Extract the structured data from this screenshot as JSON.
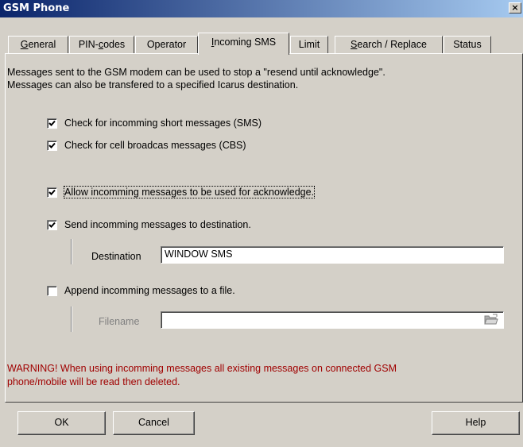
{
  "window": {
    "title": "GSM Phone",
    "close_glyph": "×"
  },
  "tabs": [
    {
      "prefix": "",
      "ul": "G",
      "rest": "eneral"
    },
    {
      "prefix": "PIN-",
      "ul": "c",
      "rest": "odes"
    },
    {
      "prefix": "Operator",
      "ul": "",
      "rest": ""
    },
    {
      "prefix": "",
      "ul": "I",
      "rest": "ncoming SMS"
    },
    {
      "prefix": "Limit",
      "ul": "",
      "rest": ""
    },
    {
      "prefix": "",
      "ul": "S",
      "rest": "earch / Replace"
    },
    {
      "prefix": "Status",
      "ul": "",
      "rest": ""
    }
  ],
  "active_tab": "Incoming SMS",
  "panel": {
    "intro_line1": "Messages sent to the GSM modem can be used to stop a \"resend until acknowledge\".",
    "intro_line2": "Messages can also be transfered to a specified Icarus destination.",
    "check_sms": {
      "label": "Check for incomming short messages (SMS)",
      "checked": true
    },
    "check_cbs": {
      "label": "Check for cell broadcas messages (CBS)",
      "checked": true
    },
    "allow_ack": {
      "label": "Allow incomming messages to be used for acknowledge.",
      "checked": true
    },
    "send_dest": {
      "label": "Send incomming messages to destination.",
      "checked": true
    },
    "destination": {
      "label": "Destination",
      "value": "WINDOW SMS"
    },
    "append_file": {
      "label": "Append incomming messages to a file.",
      "checked": false
    },
    "filename": {
      "label": "Filename",
      "value": ""
    },
    "warning_line1": "WARNING! When using incomming messages all existing messages on connected GSM",
    "warning_line2": "phone/mobile will be read then deleted."
  },
  "buttons": {
    "ok": "OK",
    "cancel": "Cancel",
    "help": "Help"
  },
  "icons": {
    "browse": "folder-open-icon",
    "check": "checkmark-icon"
  },
  "colors": {
    "title_start": "#0a246a",
    "title_end": "#a6caf0",
    "face": "#d4d0c8",
    "warning": "#a00000"
  }
}
